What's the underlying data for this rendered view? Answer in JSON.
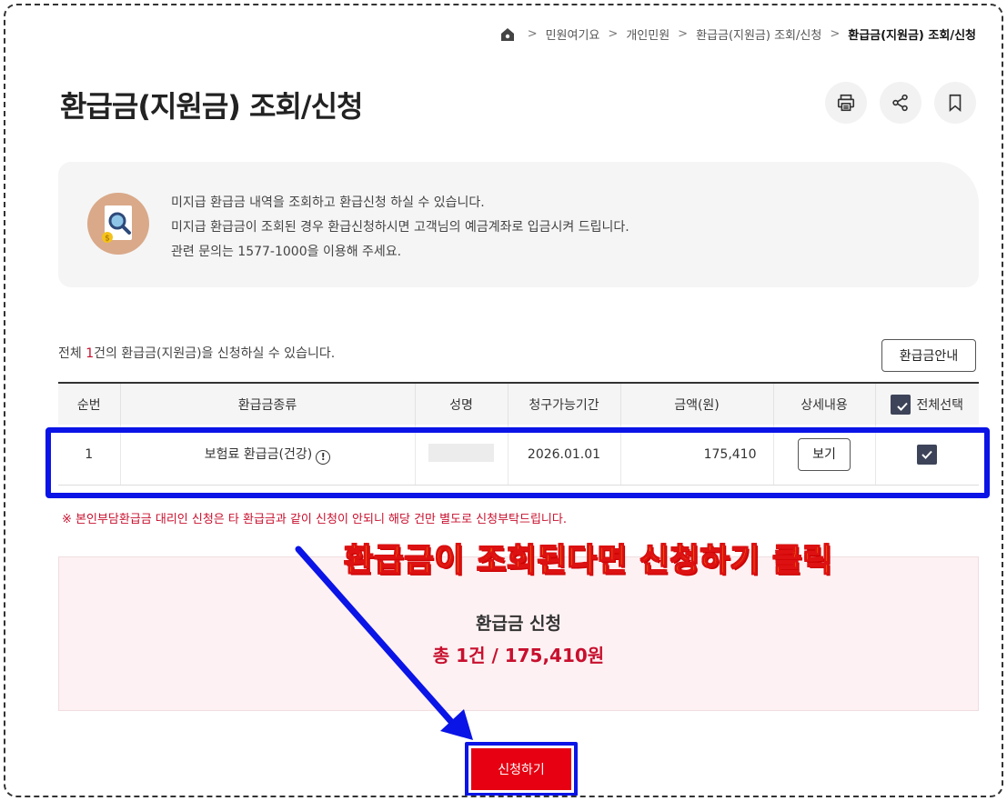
{
  "breadcrumb": {
    "items": [
      "민원여기요",
      "개인민원",
      "환급금(지원금) 조회/신청"
    ],
    "current": "환급금(지원금) 조회/신청"
  },
  "page": {
    "title": "환급금(지원금) 조회/신청"
  },
  "actions": {
    "print": "print-icon",
    "share": "share-icon",
    "bookmark": "bookmark-icon"
  },
  "info": {
    "lines": [
      "미지급 환급금 내역을 조회하고 환급신청 하실 수 있습니다.",
      "미지급 환급금이 조회된 경우 환급신청하시면 고객님의 예금계좌로 입금시켜 드립니다.",
      "관련 문의는 1577-1000을 이용해 주세요."
    ]
  },
  "summary": {
    "prefix": "전체 ",
    "count": "1",
    "suffix": "건의 환급금(지원금)을 신청하실 수 있습니다."
  },
  "guide_button": "환급금안내",
  "table": {
    "headers": [
      "순번",
      "환급금종류",
      "성명",
      "청구가능기간",
      "금액(원)",
      "상세내용",
      "전체선택"
    ],
    "rows": [
      {
        "no": "1",
        "type": "보험료 환급금(건강)",
        "name": "",
        "period": "2026.01.01",
        "amount": "175,410",
        "detail": "보기",
        "checked": true
      }
    ]
  },
  "notice": "※ 본인부담환급금 대리인 신청은 타 환급금과 같이 신청이 안되니 해당 건만 별도로 신청부탁드립니다.",
  "apply": {
    "title": "환급금 신청",
    "total": "총 1건 / 175,410원"
  },
  "annotation": "환급금이 조회된다면 신청하기 클릭",
  "submit_button": "신청하기",
  "colors": {
    "accent": "#c8102e",
    "highlight": "#0a14e6",
    "submit": "#e60012",
    "annotation": "#ffe600"
  }
}
